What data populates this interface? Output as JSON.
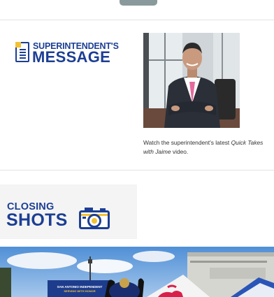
{
  "header": {
    "tab_color": "#8a9a9c"
  },
  "superintendent_message": {
    "logo_small_text": "SUPERINTENDENT'S",
    "logo_big_text": "MESSAGE",
    "logo_icon": "document-icon",
    "photo_icon": "portrait-photo",
    "caption_prefix": "Watch the superintendent's latest ",
    "caption_italic": "Quick Takes with Jaime",
    "caption_suffix": " video."
  },
  "closing_shots": {
    "word_top": "CLOSING",
    "word_bottom": "SHOTS",
    "icon": "camera-icon"
  },
  "event_photo": {
    "banner_line1": "SAN ANTONIO INDEPENDENT",
    "banner_line2": "SERVING WITH HONOR"
  },
  "colors": {
    "brand_blue": "#1c3f94",
    "accent_yellow": "#f3c233",
    "divider": "#e3e3e3"
  }
}
